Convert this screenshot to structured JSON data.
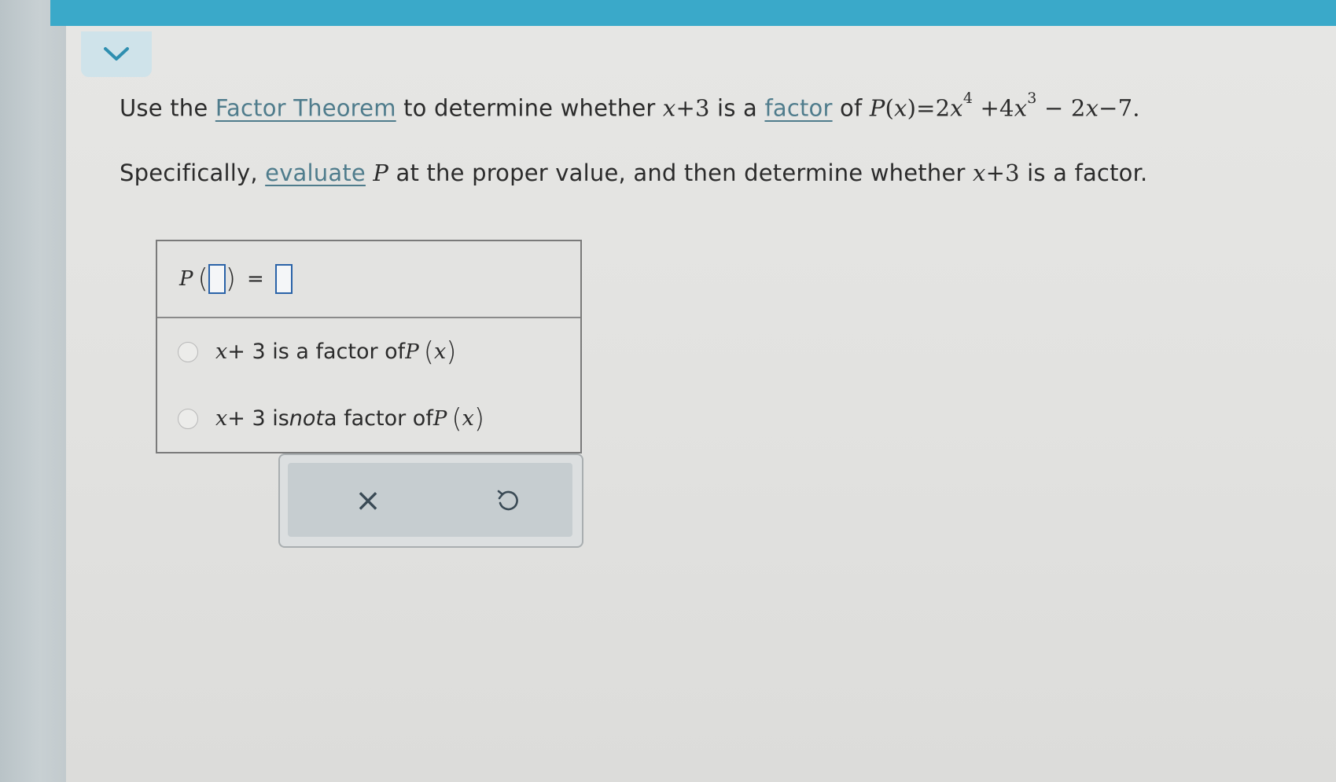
{
  "question": {
    "line1": {
      "t1": "Use the ",
      "link1": "Factor Theorem",
      "t2": " to determine whether ",
      "divisor_var": "x",
      "divisor_rest": "+3",
      "t3": " is a ",
      "link2": "factor",
      "t4": " of ",
      "p": "P",
      "px_open": "(",
      "px_var": "x",
      "px_close": ")",
      "eq": "=2",
      "x1": "x",
      "e1": "4",
      "plus": " +4",
      "x2": "x",
      "e2": "3",
      "tail_a": " − 2",
      "x3": "x",
      "tail_b": "−7."
    },
    "line2": {
      "t1": "Specifically, ",
      "link": "evaluate",
      "p": "P",
      "t2": " at the proper value, and then determine whether ",
      "divisor_var": "x",
      "divisor_rest": "+3",
      "t3": " is a factor."
    }
  },
  "answer": {
    "p_label": "P",
    "lparen": "(",
    "rparen": ")",
    "equals": "=",
    "choices": [
      {
        "var": "x",
        "t1": " + 3 is a factor of ",
        "p": "P",
        "lp": "(",
        "x": "x",
        "rp": ")"
      },
      {
        "var": "x",
        "t1": " + 3 is ",
        "em": "not",
        "t2": " a factor of ",
        "p": "P",
        "lp": "(",
        "x": "x",
        "rp": ")"
      }
    ]
  },
  "tools": {
    "clear": "×"
  },
  "colors": {
    "topbar": "#3aa9c9",
    "link": "#4f7c8c",
    "input_border": "#2a63a8"
  }
}
